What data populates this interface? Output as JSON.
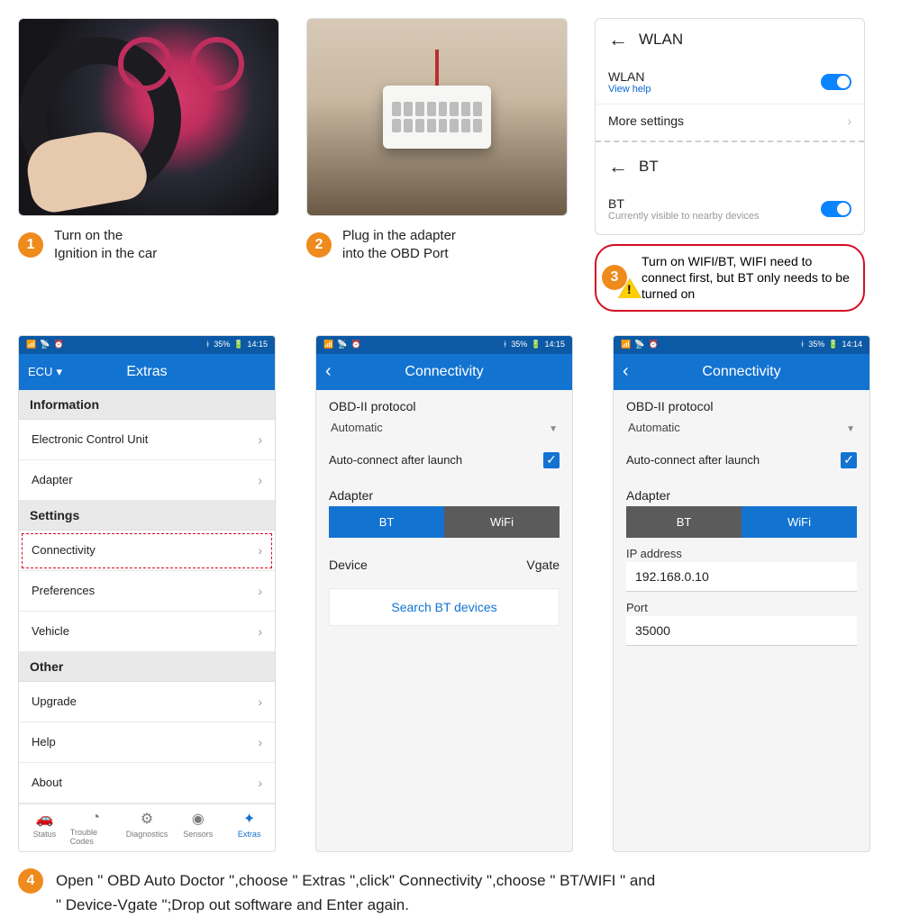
{
  "steps": {
    "s1": {
      "num": "1",
      "line1": "Turn on the",
      "line2": "Ignition in the car"
    },
    "s2": {
      "num": "2",
      "line1": "Plug in the adapter",
      "line2": "into the OBD Port"
    },
    "s3": {
      "num": "3",
      "text": "Turn on WIFI/BT, WIFI need to connect first, but BT only needs to be turned on"
    },
    "s4": {
      "num": "4",
      "line1": "Open \" OBD Auto Doctor \",choose \" Extras \",click\" Connectivity \",choose \" BT/WIFI \" and",
      "line2": "\" Device-Vgate \";Drop out software and Enter again."
    }
  },
  "wlan_card": {
    "title": "WLAN",
    "label": "WLAN",
    "help": "View help",
    "more": "More settings",
    "bt_title": "BT",
    "bt_label": "BT",
    "bt_sub": "Currently visible to nearby devices"
  },
  "statusbar": {
    "battery": "35%",
    "time_a": "14:15",
    "time_b": "14:14"
  },
  "extras": {
    "back": "ECU",
    "title": "Extras",
    "sections": {
      "info": "Information",
      "info_items": [
        "Electronic Control Unit",
        "Adapter"
      ],
      "settings": "Settings",
      "settings_items": [
        "Connectivity",
        "Preferences",
        "Vehicle"
      ],
      "other": "Other",
      "other_items": [
        "Upgrade",
        "Help",
        "About"
      ]
    },
    "tabs": [
      "Status",
      "Trouble Codes",
      "Diagnostics",
      "Sensors",
      "Extras"
    ]
  },
  "connectivity": {
    "title": "Connectivity",
    "protocol_label": "OBD-II protocol",
    "protocol_value": "Automatic",
    "autoconnect": "Auto-connect after launch",
    "adapter_label": "Adapter",
    "bt": "BT",
    "wifi": "WiFi",
    "device_label": "Device",
    "device_value": "Vgate",
    "search": "Search  BT  devices",
    "ip_label": "IP address",
    "ip_value": "192.168.0.10",
    "port_label": "Port",
    "port_value": "35000"
  }
}
